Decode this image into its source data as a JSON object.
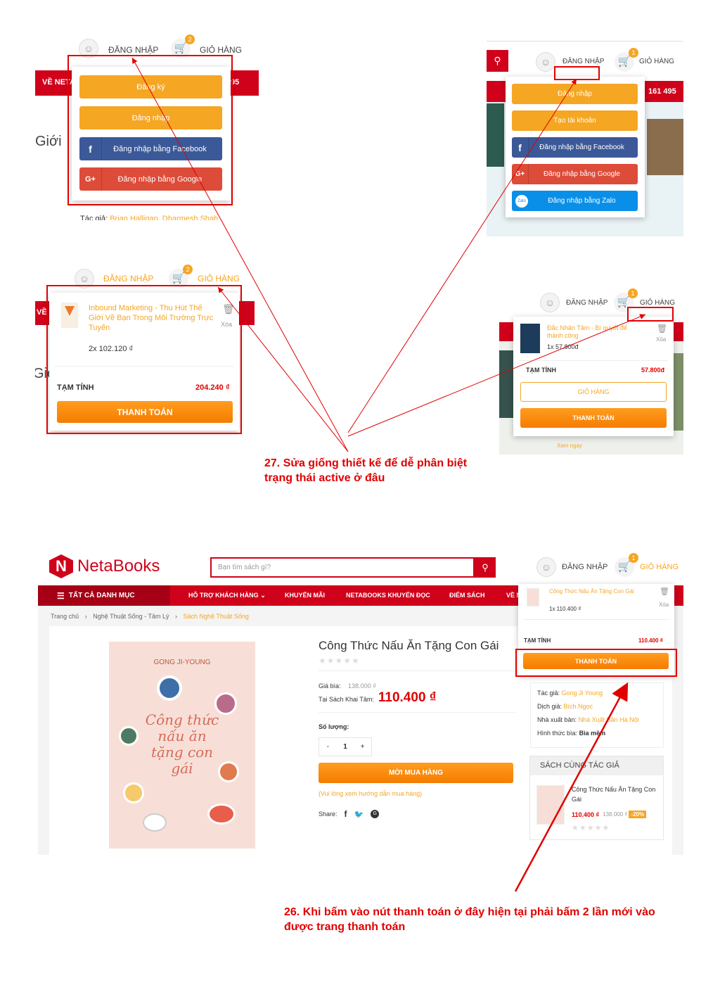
{
  "header_login": "ĐĂNG NHẬP",
  "header_cart": "GIỎ HÀNG",
  "cart_badge_2": "2",
  "cart_badge_1": "1",
  "p1": {
    "menu_left": "VỀ NETA",
    "right_num": "95",
    "bg_text": "Giới",
    "btn_register": "Đăng ký",
    "btn_login": "Đăng nhập",
    "btn_facebook": "Đăng nhập bằng Facebook",
    "btn_google": "Đăng nhập bằng Google",
    "author_label": "Tác giả:",
    "author_value": "Brian Halligan, Dharmesh Shah"
  },
  "p2": {
    "phone": "161 495",
    "btn_login": "Đăng nhập",
    "btn_create": "Tạo tài khoản",
    "btn_facebook": "Đăng nhập bằng Facebook",
    "btn_google": "Đăng nhập bằng Google",
    "btn_zalo": "Đăng nhập bằng Zalo",
    "zalo_icon_text": "Zalo"
  },
  "p3": {
    "menu_left": "VỀ N",
    "bg_text": "Giớ",
    "item_title": "Inbound Marketing - Thu Hút Thế Giới Về Bạn Trong Môi Trường Trực Tuyến",
    "item_qty": "2x 102.120 ₫",
    "delete": "Xóa",
    "subtotal_label": "TẠM TÍNH",
    "subtotal_value": "204.240 ₫",
    "checkout": "THANH TOÁN"
  },
  "p4": {
    "item_title": "Đắc Nhân Tâm - Bí quyết để thành công",
    "item_qty": "1x 57.800đ",
    "delete": "Xóa",
    "subtotal_label": "TẠM TÍNH",
    "subtotal_value": "57.800đ",
    "cart_btn": "GIỎ HÀNG",
    "checkout": "THANH TOÁN",
    "bg_link": "Xem ngay"
  },
  "annotation_27": "27. Sửa giống thiết kế để dễ phân biệt trạng thái active ở đâu",
  "main": {
    "logo": "NetaBooks",
    "logo_neta": "Neta",
    "logo_books": "Books",
    "search_placeholder": "Bạn tìm sách gì?",
    "nav": [
      "TẤT CẢ DANH MỤC",
      "HỖ TRỢ KHÁCH HÀNG",
      "KHUYẾN MÃI",
      "NETABOOKS KHUYẾN ĐỌC",
      "ĐIỂM SÁCH",
      "VỀ N"
    ],
    "breadcrumb": [
      "Trang chủ",
      "Nghệ Thuật Sống - Tâm Lý",
      "Sách Nghệ Thuật Sống"
    ],
    "cover_author": "GONG JI-YOUNG",
    "cover_title": "Công thức nấu ăn tặng con gái",
    "product_title": "Công Thức Nấu Ăn Tặng Con Gái",
    "stars": "★★★★★",
    "cover_price_label": "Giá bìa:",
    "cover_price": "138.000 ₫",
    "store_price_label": "Tại Sách Khai Tâm:",
    "store_price": "110.400 ₫",
    "qty_label": "Số lượng:",
    "qty_minus": "-",
    "qty_value": "1",
    "qty_plus": "+",
    "buy_btn": "MỜI MUA HÀNG",
    "buy_guide": "(Vui lòng xem hướng dẫn mua hàng)",
    "share_label": "Share:",
    "cart_item": "Công Thức Nấu Ăn Tặng Con Gái",
    "cart_qty": "1x 110.400 ₫",
    "cart_delete": "Xóa",
    "cart_subtotal_label": "TẠM TÍNH",
    "cart_subtotal": "110.400 ₫",
    "cart_checkout": "THANH TOÁN",
    "info_author_label": "Tác giả:",
    "info_author": "Gong Ji Young",
    "info_translator_label": "Dịch giả:",
    "info_translator": "Bích Ngọc",
    "info_publisher_label": "Nhà xuất bản:",
    "info_publisher": "Nhà Xuất Bản Hà Nội",
    "info_format_label": "Hình thức bìa:",
    "info_format": "Bìa mềm",
    "same_author_title": "SÁCH CÙNG TÁC GIẢ",
    "same_item_title": "Công Thức Nấu Ăn Tặng Con Gái",
    "same_item_price": "110.400 ₫",
    "same_item_old": "138.000 ₫",
    "same_item_discount": "-20%"
  },
  "annotation_26": "26. Khi bấm vào nút thanh toán ở đây hiện tại phải bấm 2 lần mới vào được trang thanh toán",
  "colors": {
    "brand_red": "#d0021b",
    "accent_orange": "#f5a623",
    "annotation_red": "#e00000"
  }
}
